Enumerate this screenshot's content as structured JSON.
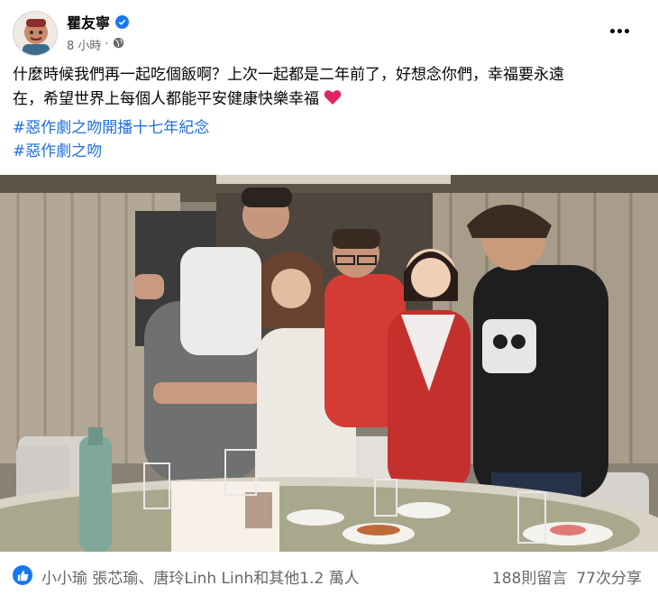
{
  "post": {
    "author": "瞿友寧",
    "time": "8 小時",
    "privacy_icon": "globe-icon",
    "text_line1": "什麼時候我們再一起吃個飯啊？上次一起都是二年前了，好想念你們，幸福要永遠",
    "text_line2": "在，希望世界上每個人都能平安健康快樂幸福",
    "hashtags": [
      "#惡作劇之吻開播十七年紀念",
      "#惡作劇之吻"
    ]
  },
  "reactions": {
    "summary": "小小瑜 張芯瑜、唐玲Linh Linh和其他1.2 萬人",
    "comments": "188則留言",
    "shares": "77次分享"
  },
  "colors": {
    "link": "#216fdb",
    "reaction_blue": "#1877f2",
    "meta_gray": "#65676b",
    "heart_red": "#e0245e"
  }
}
